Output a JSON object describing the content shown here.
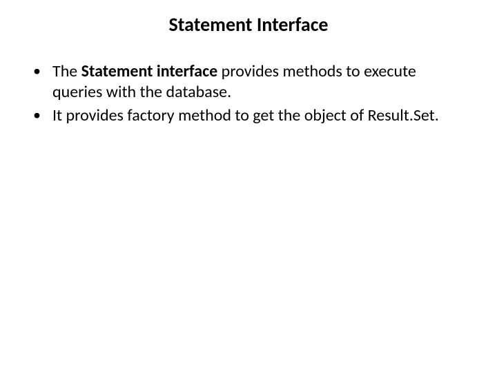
{
  "title": "Statement Interface",
  "bullets": [
    {
      "prefix": "The ",
      "bold": "Statement interface",
      "suffix": " provides methods to execute queries with the database."
    },
    {
      "prefix": "",
      "bold": "",
      "suffix": "It provides factory method to get the object of Result.Set."
    }
  ]
}
